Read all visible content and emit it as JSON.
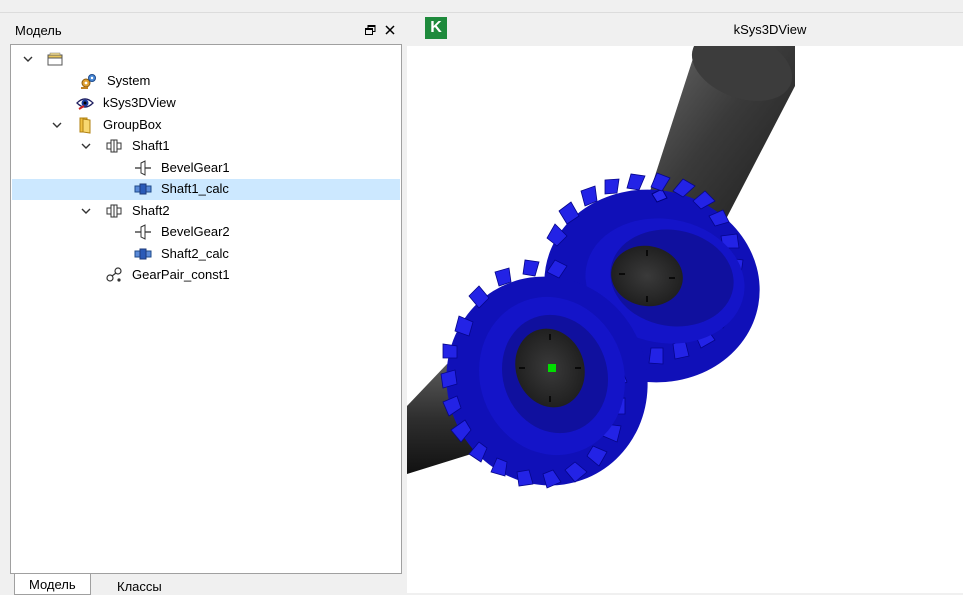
{
  "dock": {
    "title": "Модель",
    "float_icon": "restore-icon",
    "close_icon": "close-icon"
  },
  "tree": {
    "items": [
      {
        "label": "",
        "icon": "root-window-icon",
        "expanded": true
      },
      {
        "label": "System",
        "icon": "system-gears-icon"
      },
      {
        "label": "kSys3DView",
        "icon": "3d-view-eye-icon"
      },
      {
        "label": "GroupBox",
        "icon": "folder-icon",
        "expanded": true
      },
      {
        "label": "Shaft1",
        "icon": "shaft-icon",
        "expanded": true
      },
      {
        "label": "BevelGear1",
        "icon": "bevel-gear-icon"
      },
      {
        "label": "Shaft1_calc",
        "icon": "shaft-calc-icon",
        "selected": true
      },
      {
        "label": "Shaft2",
        "icon": "shaft-icon",
        "expanded": true
      },
      {
        "label": "BevelGear2",
        "icon": "bevel-gear-icon"
      },
      {
        "label": "Shaft2_calc",
        "icon": "shaft-calc-icon"
      },
      {
        "label": "GearPair_const1",
        "icon": "gear-pair-constraint-icon"
      }
    ]
  },
  "tabs": [
    {
      "label": "Модель",
      "active": true
    },
    {
      "label": "Классы",
      "active": false
    }
  ],
  "view": {
    "logo": "K",
    "title": "kSys3DView",
    "colors": {
      "gear": "#1a1ae6",
      "shaft": "#2a2a2a",
      "marker": "#00dd00"
    }
  }
}
